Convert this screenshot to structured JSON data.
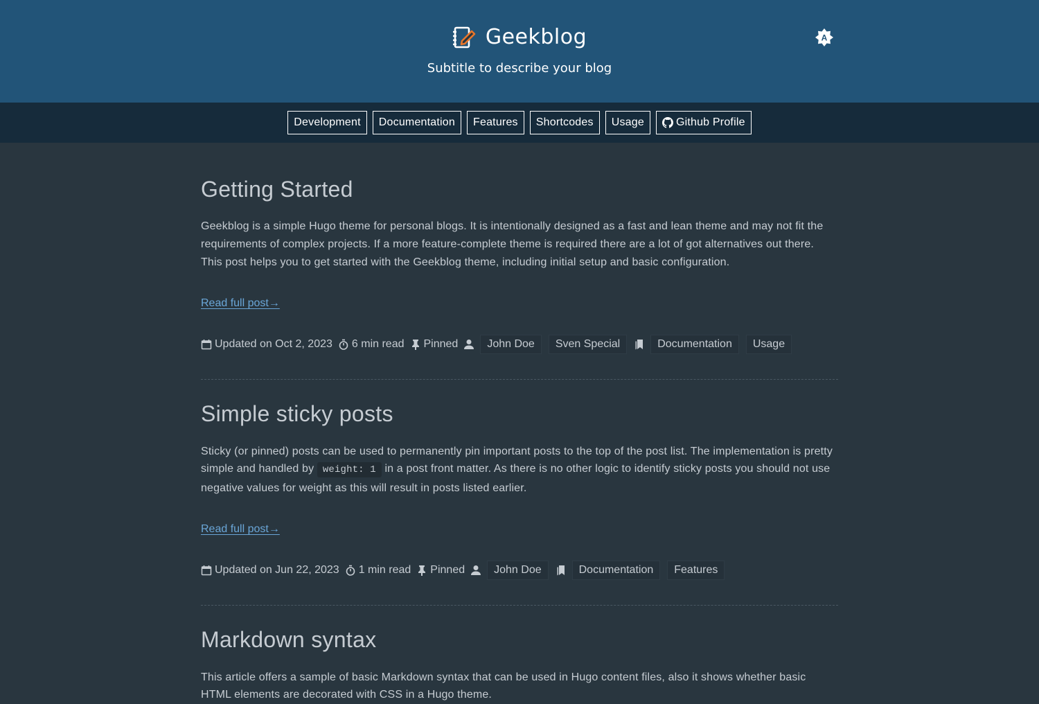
{
  "header": {
    "title": "Geekblog",
    "subtitle": "Subtitle to describe your blog",
    "logo_icon": "notebook-pen-icon",
    "theme_icon": "auto-theme-icon",
    "colors": {
      "header_bg": "#225478",
      "menu_bg": "#162b3b",
      "page_bg": "#29363f",
      "accent": "#e8762b",
      "link": "#6aa6d8"
    }
  },
  "menu": {
    "items": [
      {
        "label": "Development"
      },
      {
        "label": "Documentation"
      },
      {
        "label": "Features"
      },
      {
        "label": "Shortcodes"
      },
      {
        "label": "Usage"
      },
      {
        "label": "Github Profile",
        "icon": "github-icon"
      }
    ]
  },
  "posts": [
    {
      "title": "Getting Started",
      "text": "Geekblog is a simple Hugo theme for personal blogs. It is intentionally designed as a fast and lean theme and may not fit the requirements of complex projects. If a more feature-complete theme is required there are a lot of got alternatives out there. This post helps you to get started with the Geekblog theme, including initial setup and basic configuration.",
      "read_more": "Read full post→",
      "updated": "Updated on Oct 2, 2023",
      "read_time": "6 min read",
      "pinned": "Pinned",
      "authors": [
        "John Doe",
        "Sven Special"
      ],
      "tags": [
        "Documentation",
        "Usage"
      ]
    },
    {
      "title": "Simple sticky posts",
      "text_before": "Sticky (or pinned) posts can be used to permanently pin important posts to the top of the post list. The implementation is pretty simple and handled by",
      "code": "weight: 1",
      "text_after": "in a post front matter. As there is no other logic to identify sticky posts you should not use negative values for weight as this will result in posts listed earlier.",
      "read_more": "Read full post→",
      "updated": "Updated on Jun 22, 2023",
      "read_time": "1 min read",
      "pinned": "Pinned",
      "authors": [
        "John Doe"
      ],
      "tags": [
        "Documentation",
        "Features"
      ]
    },
    {
      "title": "Markdown syntax",
      "text": "This article offers a sample of basic Markdown syntax that can be used in Hugo content files, also it shows whether basic HTML elements are decorated with CSS in a Hugo theme."
    }
  ]
}
